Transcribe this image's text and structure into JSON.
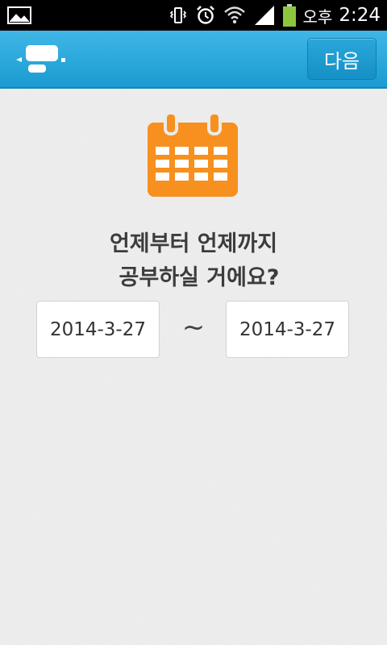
{
  "status_bar": {
    "ampm": "오후",
    "time": "2:24",
    "icons": [
      "gallery-icon",
      "vibrate-icon",
      "alarm-icon",
      "wifi-icon",
      "signal-icon",
      "battery-icon"
    ],
    "battery_color": "#8cc63f"
  },
  "action_bar": {
    "logo": "app-logo-icon",
    "next_label": "다음",
    "color": "#26a8dd"
  },
  "main": {
    "icon": "calendar-icon",
    "icon_color": "#f7901e",
    "question_line1": "언제부터 언제까지",
    "question_line2": "공부하실 거에요?",
    "start_date": "2014-3-27",
    "separator": "~",
    "end_date": "2014-3-27"
  }
}
